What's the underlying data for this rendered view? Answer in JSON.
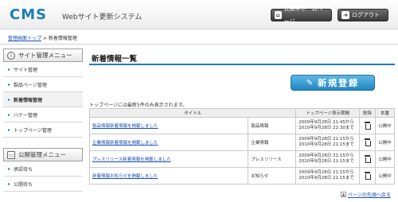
{
  "header": {
    "logo": "CMS",
    "subtitle": "Webサイト更新システム",
    "home_button": "公開中ホームページ",
    "logout_button": "ログアウト"
  },
  "breadcrumb": {
    "link": "管理画面トップ",
    "separator": ">",
    "current": "新着情報管理"
  },
  "sidebar": {
    "site_menu": {
      "title": "サイト管理メニュー",
      "items": [
        {
          "label": "サイト管理"
        },
        {
          "label": "製品ページ管理"
        },
        {
          "label": "新着情報管理"
        },
        {
          "label": "バナー管理"
        },
        {
          "label": "トップページ管理"
        }
      ]
    },
    "public_menu": {
      "title": "公開管理メニュー",
      "items": [
        {
          "label": "承認待ち"
        },
        {
          "label": "公開待ち"
        }
      ]
    }
  },
  "main": {
    "title": "新着情報一覧",
    "new_button": "新規登録",
    "note": "トップページには最新5件のみ表示されます。",
    "columns": [
      "タイトル",
      "トップページ表示期間",
      "削除",
      "本番"
    ],
    "rows": [
      {
        "title": "製品情報新着情報を掲載しました",
        "category": "製品情報",
        "period_start": "2009年9月28日 21:45から",
        "period_end": "2010年9月28日 22:30まで",
        "status": "公開中"
      },
      {
        "title": "企業情報新着情報を掲載しました",
        "category": "企業情報",
        "period_start": "2009年9月28日 21:15から",
        "period_end": "2010年9月28日 21:15まで",
        "status": "公開中"
      },
      {
        "title": "プレスリリース新着情報を掲載しました",
        "category": "プレスリリース",
        "period_start": "2009年9月28日 21:15から",
        "period_end": "2010年9月28日 21:15まで",
        "status": "公開中"
      },
      {
        "title": "新着情報お知らせを掲載しました",
        "category": "お知らせ",
        "period_start": "2009年9月28日 21:15から",
        "period_end": "2010年9月28日 21:15まで",
        "status": "公開中"
      }
    ],
    "to_top": "ページの先頭へ戻る"
  },
  "colors": {
    "accent": "#1e7fb4",
    "link": "#1a4fb8"
  }
}
